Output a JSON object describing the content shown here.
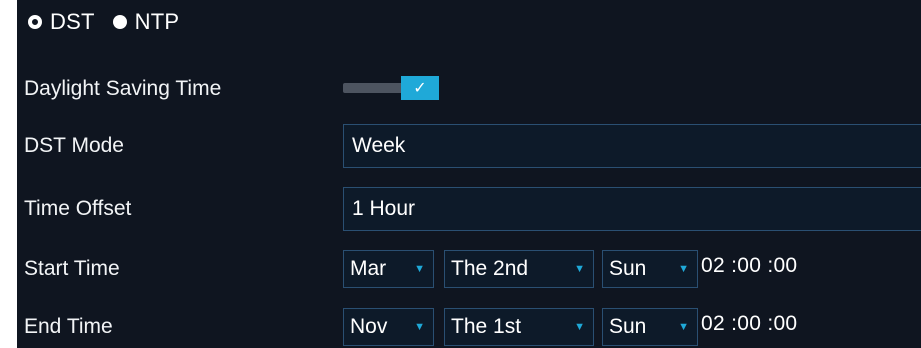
{
  "tabs": [
    {
      "label": "DST",
      "selected": true
    },
    {
      "label": "NTP",
      "selected": false
    }
  ],
  "daylight_saving": {
    "label": "Daylight Saving Time",
    "enabled": true,
    "check_icon": "✓"
  },
  "dst_mode": {
    "label": "DST Mode",
    "value": "Week"
  },
  "time_offset": {
    "label": "Time Offset",
    "value": "1 Hour"
  },
  "start_time": {
    "label": "Start Time",
    "month": "Mar",
    "week": "The 2nd",
    "day": "Sun",
    "time": "02 :00 :00"
  },
  "end_time": {
    "label": "End Time",
    "month": "Nov",
    "week": "The 1st",
    "day": "Sun",
    "time": "02 :00 :00"
  },
  "colors": {
    "accent": "#1fa9d8",
    "panel_bg": "#0f1520",
    "field_border": "#2a4f72"
  },
  "icons": {
    "dropdown": "caret-down-icon",
    "check": "check-icon"
  }
}
